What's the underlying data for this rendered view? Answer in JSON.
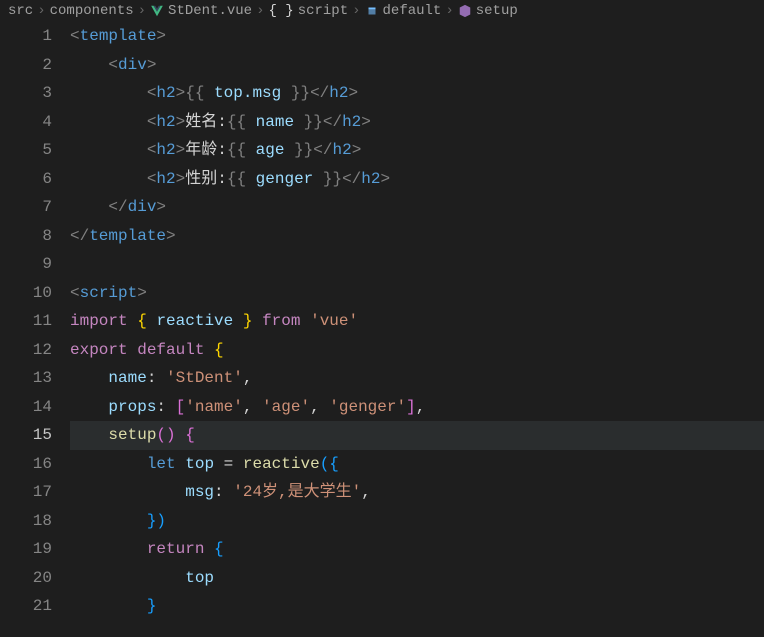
{
  "breadcrumb": {
    "parts": [
      "src",
      "components",
      "StDent.vue",
      "script",
      "default",
      "setup"
    ],
    "sep": "›"
  },
  "lines": {
    "start": 1,
    "count": 21,
    "active": 15
  },
  "code": {
    "top_msg_expr": "top.msg",
    "name_label": "姓名:",
    "name_expr": "name",
    "age_label": "年龄:",
    "age_expr": "age",
    "gender_label": "性别:",
    "gender_expr": "genger",
    "import_kw": "import",
    "reactive_fn": "reactive",
    "from_kw": "from",
    "vue_str": "'vue'",
    "export_kw": "export",
    "default_kw": "default",
    "name_prop": "name",
    "name_val": "'StDent'",
    "props_prop": "props",
    "props_vals": [
      "'name'",
      "'age'",
      "'genger'"
    ],
    "setup_fn": "setup",
    "let_kw": "let",
    "top_var": "top",
    "msg_prop": "msg",
    "msg_val": "'24岁,是大学生'",
    "return_kw": "return",
    "tag_template": "template",
    "tag_div": "div",
    "tag_h2": "h2",
    "tag_script": "script"
  }
}
